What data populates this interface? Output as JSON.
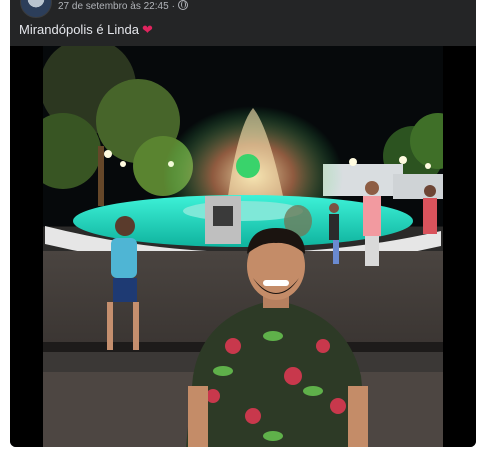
{
  "post": {
    "timestamp": "27 de setembro às 22:45",
    "separator": "·",
    "privacy_icon": "globe-icon",
    "caption": "Mirandópolis é Linda",
    "caption_emoji": "❤"
  },
  "photo": {
    "subject": "man in floral shirt smiling in front of lit fountain at night"
  },
  "colors": {
    "post_bg": "#242526",
    "text_primary": "#e4e6eb",
    "text_secondary": "#b0b3b8",
    "heart": "#e0245e"
  }
}
